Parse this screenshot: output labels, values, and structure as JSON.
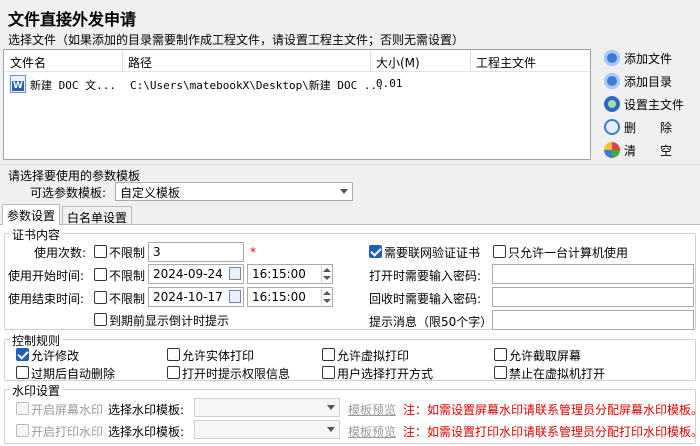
{
  "window": {
    "title": "文件直接外发申请",
    "subtitle": "选择文件（如果添加的目录需要制作成工程文件，请设置工程主文件；否则无需设置）"
  },
  "files": {
    "columns": [
      "文件名",
      "路径",
      "大小(M)",
      "工程主文件"
    ],
    "rows": [
      {
        "name": "新建 DOC 文...",
        "path": "C:\\Users\\matebookX\\Desktop\\新建 DOC ...",
        "size": "0.01",
        "main": ""
      }
    ]
  },
  "side_buttons": {
    "add_file": "添加文件",
    "add_dir": "添加目录",
    "set_main": "设置主文件",
    "delete": "删　　除",
    "clear": "清　　空"
  },
  "template": {
    "section": "请选择要使用的参数模板",
    "label": "可选参数模板:",
    "value": "自定义模板"
  },
  "tabs": [
    "参数设置",
    "白名单设置"
  ],
  "cert": {
    "group_title": "证书内容",
    "use_count_label": "使用次数:",
    "no_limit": "不限制",
    "use_count_value": "3",
    "required_mark": "*",
    "start_label": "使用开始时间:",
    "start_date": "2024-09-24",
    "start_time": "16:15:00",
    "end_label": "使用结束时间:",
    "end_date": "2024-10-17",
    "end_time": "16:15:00",
    "countdown": "到期前显示倒计时提示",
    "network_verify": "需要联网验证证书",
    "one_pc": "只允许一台计算机使用",
    "open_pwd": "打开时需要输入密码:",
    "recycle_pwd": "回收时需要输入密码:",
    "hint_msg": "提示消息（限50个字）:"
  },
  "rules": {
    "group_title": "控制规则",
    "items": [
      {
        "label": "允许修改",
        "checked": true
      },
      {
        "label": "允许实体打印",
        "checked": false
      },
      {
        "label": "允许虚拟打印",
        "checked": false
      },
      {
        "label": "允许截取屏幕",
        "checked": false
      },
      {
        "label": "过期后自动删除",
        "checked": false
      },
      {
        "label": "打开时提示权限信息",
        "checked": false
      },
      {
        "label": "用户选择打开方式",
        "checked": false
      },
      {
        "label": "禁止在虚拟机打开",
        "checked": false
      }
    ]
  },
  "watermark": {
    "group_title": "水印设置",
    "screen_label": "开启屏幕水印",
    "print_label": "开启打印水印",
    "template_label": "选择水印模板:",
    "preview": "模板预览",
    "screen_note": "注：如需设置屏幕水印请联系管理员分配屏幕水印模板。",
    "print_note": "注：如需设置打印水印请联系管理员分配打印水印模板。"
  },
  "colors": {
    "accent": "#1f5fbf",
    "warning": "#e00000"
  }
}
